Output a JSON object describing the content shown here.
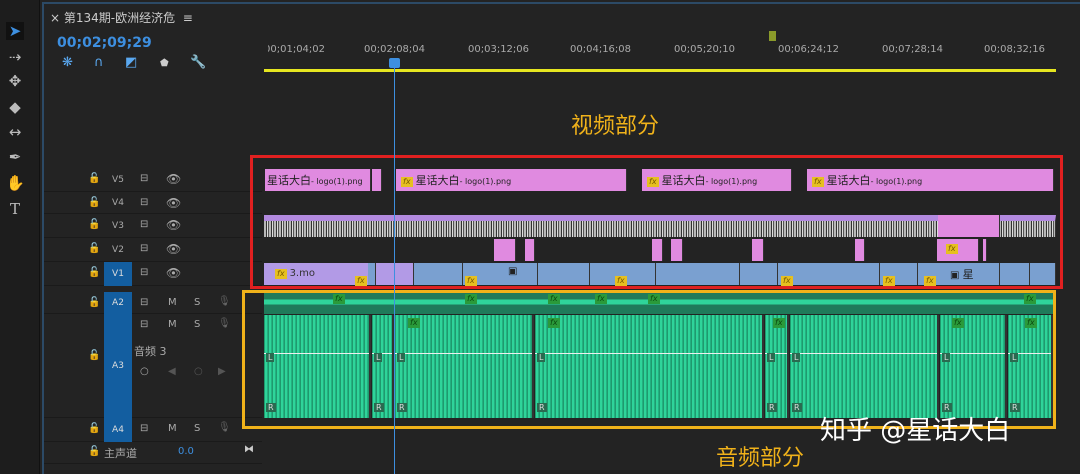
{
  "sequence": {
    "tab_title": "第134期-欧洲经济危",
    "menu_icon": "≡",
    "timecode": "00;02;09;29"
  },
  "ruler": {
    "labels": [
      "00;01;04;02",
      "00;02;08;04",
      "00;03;12;06",
      "00;04;16;08",
      "00;05;20;10",
      "00;06;24;12",
      "00;07;28;14",
      "00;08;32;16"
    ]
  },
  "tracks": {
    "video": [
      "V5",
      "V4",
      "V3",
      "V2",
      "V1"
    ],
    "audio": [
      "A2",
      "A3",
      "A4"
    ],
    "a3_name": "音频 3",
    "mute": "M",
    "solo": "S",
    "master_label": "主声道",
    "master_value": "0.0"
  },
  "clips": {
    "logo_title": "星话大白",
    "logo_file": "- logo(1).png",
    "v1_first": "3.mo",
    "v1_img": "星",
    "fx": "fx",
    "left": "L",
    "right": "R"
  },
  "annotations": {
    "video": "视频部分",
    "audio": "音频部分"
  },
  "watermark": "知乎 @星话大白",
  "colors": {
    "accent": "#3d8fe0",
    "video_box": "#e02020",
    "audio_box": "#f0b21a",
    "timeline_bar": "#e6e620"
  }
}
